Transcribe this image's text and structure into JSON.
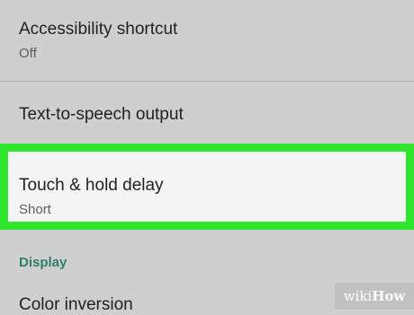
{
  "settings": {
    "accessibility_shortcut": {
      "title": "Accessibility shortcut",
      "summary": "Off"
    },
    "tts_output": {
      "title": "Text-to-speech output"
    },
    "touch_hold_delay": {
      "title": "Touch & hold delay",
      "summary": "Short"
    },
    "display_section": {
      "header": "Display"
    },
    "color_inversion": {
      "title": "Color inversion"
    }
  },
  "watermark": {
    "prefix": "wiki",
    "brand": "How"
  },
  "colors": {
    "background": "#cfcfcf",
    "highlight": "#2ee62e",
    "section_header": "#2f7d6d"
  }
}
